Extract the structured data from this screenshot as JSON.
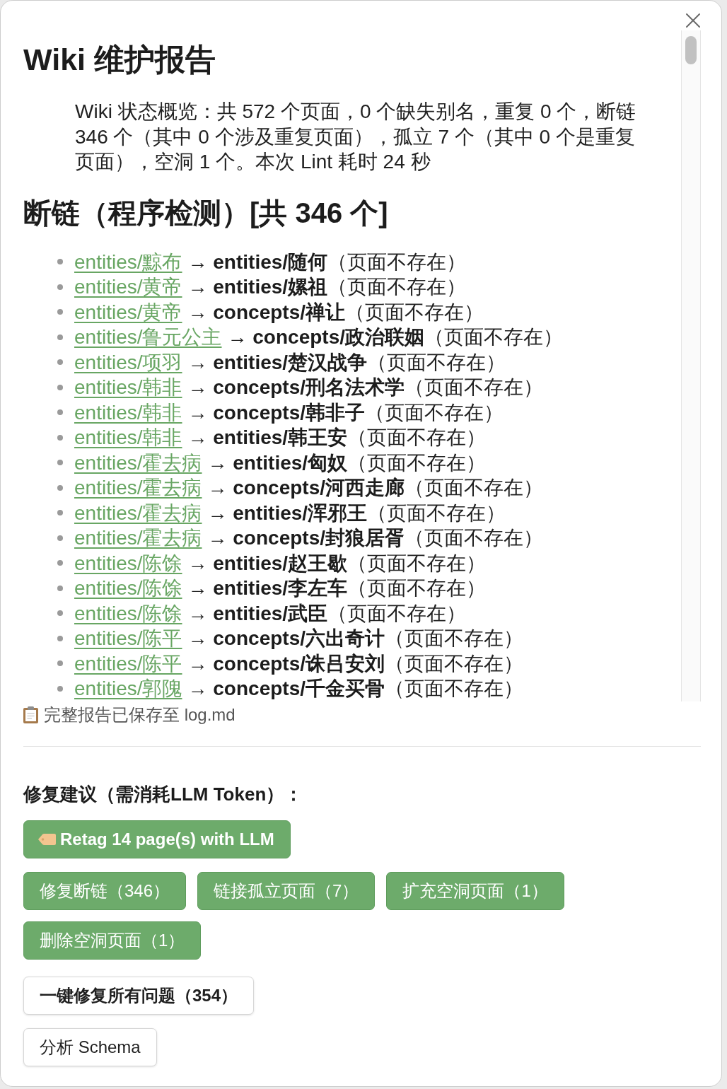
{
  "dialog": {
    "title": "Wiki 维护报告",
    "summary": "Wiki 状态概览：共 572 个页面，0 个缺失别名，重复 0 个，断链 346 个（其中 0 个涉及重复页面），孤立 7 个（其中 0 个是重复页面），空洞 1 个。本次 Lint 耗时 24 秒",
    "broken_links": {
      "heading": "断链（程序检测）[共 346 个]",
      "items": [
        {
          "source": "entities/黥布",
          "arrow": "→",
          "target": "entities/随何",
          "note": "（页面不存在）"
        },
        {
          "source": "entities/黄帝",
          "arrow": "→",
          "target": "entities/嫘祖",
          "note": "（页面不存在）"
        },
        {
          "source": "entities/黄帝",
          "arrow": "→",
          "target": "concepts/禅让",
          "note": "（页面不存在）"
        },
        {
          "source": "entities/鲁元公主",
          "arrow": "→",
          "target": "concepts/政治联姻",
          "note": "（页面不存在）"
        },
        {
          "source": "entities/项羽",
          "arrow": "→",
          "target": "entities/楚汉战争",
          "note": "（页面不存在）"
        },
        {
          "source": "entities/韩非",
          "arrow": "→",
          "target": "concepts/刑名法术学",
          "note": "（页面不存在）"
        },
        {
          "source": "entities/韩非",
          "arrow": "→",
          "target": "concepts/韩非子",
          "note": "（页面不存在）"
        },
        {
          "source": "entities/韩非",
          "arrow": "→",
          "target": "entities/韩王安",
          "note": "（页面不存在）"
        },
        {
          "source": "entities/霍去病",
          "arrow": "→",
          "target": "entities/匈奴",
          "note": "（页面不存在）"
        },
        {
          "source": "entities/霍去病",
          "arrow": "→",
          "target": "concepts/河西走廊",
          "note": "（页面不存在）"
        },
        {
          "source": "entities/霍去病",
          "arrow": "→",
          "target": "entities/浑邪王",
          "note": "（页面不存在）"
        },
        {
          "source": "entities/霍去病",
          "arrow": "→",
          "target": "concepts/封狼居胥",
          "note": "（页面不存在）"
        },
        {
          "source": "entities/陈馀",
          "arrow": "→",
          "target": "entities/赵王歇",
          "note": "（页面不存在）"
        },
        {
          "source": "entities/陈馀",
          "arrow": "→",
          "target": "entities/李左车",
          "note": "（页面不存在）"
        },
        {
          "source": "entities/陈馀",
          "arrow": "→",
          "target": "entities/武臣",
          "note": "（页面不存在）"
        },
        {
          "source": "entities/陈平",
          "arrow": "→",
          "target": "concepts/六出奇计",
          "note": "（页面不存在）"
        },
        {
          "source": "entities/陈平",
          "arrow": "→",
          "target": "concepts/诛吕安刘",
          "note": "（页面不存在）"
        },
        {
          "source": "entities/郭隗",
          "arrow": "→",
          "target": "concepts/千金买骨",
          "note": "（页面不存在）"
        }
      ]
    },
    "saved_note": "完整报告已保存至 log.md",
    "suggestions": {
      "heading": "修复建议（需消耗LLM Token）：",
      "retag_button": "Retag 14 page(s) with LLM",
      "fix_buttons": [
        "修复断链（346）",
        "链接孤立页面（7）",
        "扩充空洞页面（1）",
        "删除空洞页面（1）"
      ],
      "fix_all_button": "一键修复所有问题（354）",
      "schema_button": "分析 Schema"
    }
  }
}
